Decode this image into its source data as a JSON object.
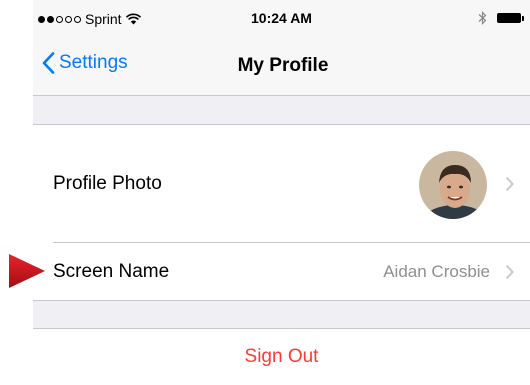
{
  "status_bar": {
    "carrier": "Sprint",
    "time": "10:24 AM",
    "signal_bars_filled": 2,
    "signal_bars_total": 5
  },
  "nav": {
    "back_label": "Settings",
    "title": "My Profile"
  },
  "rows": [
    {
      "label": "Profile Photo",
      "icon": "avatar"
    },
    {
      "label": "Screen Name",
      "value": "Aidan Crosbie"
    }
  ],
  "sign_out_label": "Sign Out",
  "colors": {
    "accent": "#007aff",
    "destructive": "#ff3b30",
    "secondary_text": "#8e8e93",
    "pointer_arrow": "#d0121b"
  }
}
